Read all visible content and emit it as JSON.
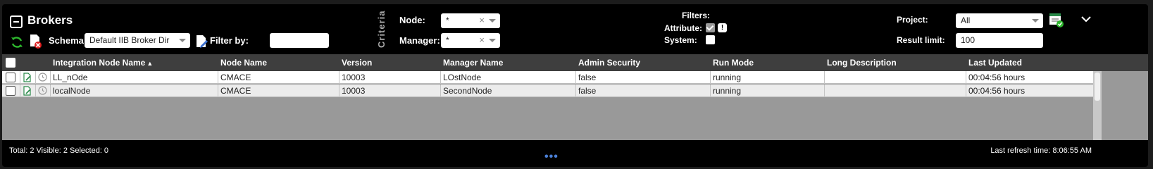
{
  "header": {
    "title": "Brokers",
    "schema_label": "Schema:",
    "schema_value": "Default IIB Broker Dir",
    "filter_by_label": "Filter by:",
    "filter_by_value": "",
    "criteria_label": "Criteria",
    "node_label": "Node:",
    "node_value": "*",
    "manager_label": "Manager:",
    "manager_value": "*",
    "filters_label": "Filters:",
    "attribute_label": "Attribute:",
    "attribute_info": "!",
    "system_label": "System:",
    "project_label": "Project:",
    "project_value": "All",
    "result_limit_label": "Result limit:",
    "result_limit_value": "100",
    "clear_glyph": "×"
  },
  "grid": {
    "columns": [
      "Integration Node Name",
      "Node Name",
      "Version",
      "Manager Name",
      "Admin Security",
      "Run Mode",
      "Long Description",
      "Last Updated"
    ],
    "sort_indicator": "▲",
    "rows": [
      [
        "LL_nOde",
        "CMACE",
        "10003",
        "LOstNode",
        "false",
        "running",
        "",
        "00:04:56 hours"
      ],
      [
        "localNode",
        "CMACE",
        "10003",
        "SecondNode",
        "false",
        "running",
        "",
        "00:04:56 hours"
      ]
    ]
  },
  "footer": {
    "counts": "Total: 2 Visible: 2 Selected: 0",
    "refresh": "Last refresh time: 8:06:55 AM",
    "more": "•••"
  },
  "colors": {
    "refresh_icon": "#2eb82e",
    "delete_icon": "#e02020",
    "accent_dots": "#4a7fd6"
  }
}
